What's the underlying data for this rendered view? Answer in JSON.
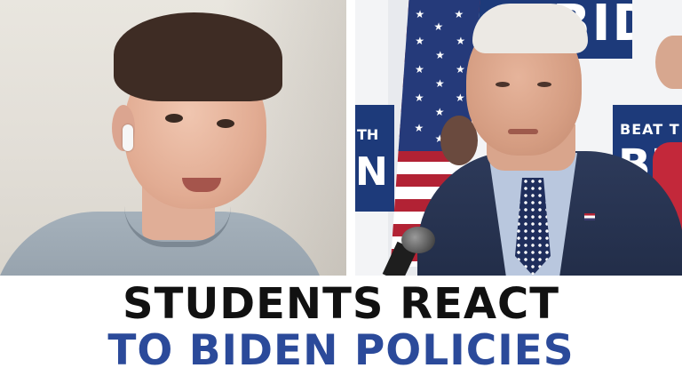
{
  "headline": {
    "line1": "STUDENTS REACT",
    "line2": "TO BIDEN POLICIES"
  },
  "signs": {
    "top": "BIDEN",
    "left_small": "TH",
    "left_big": "N",
    "right_small": "BEAT T",
    "right_big": "BI"
  },
  "colors": {
    "headline_line1": "#111111",
    "headline_line2": "#2b4a9a",
    "sign_blue": "#1d3a7a",
    "background": "#ffffff"
  }
}
